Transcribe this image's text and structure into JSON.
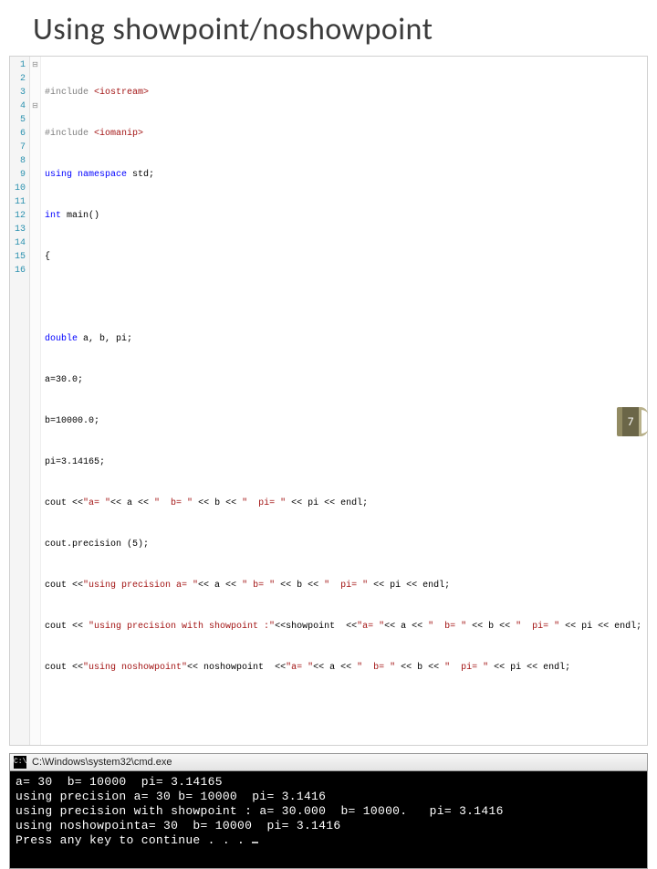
{
  "title": "Using showpoint/noshowpoint",
  "code": {
    "line_numbers": [
      "1",
      "2",
      "3",
      "4",
      "5",
      "6",
      "7",
      "8",
      "9",
      "10",
      "11",
      "12",
      "13",
      "14",
      "15",
      "16"
    ],
    "fold_markers": [
      "⊟",
      "",
      "",
      "⊟",
      "",
      "",
      "",
      "",
      "",
      "",
      "",
      "",
      "",
      "",
      "",
      ""
    ],
    "lines": {
      "l1_pp": "#include ",
      "l1_inc": "<iostream>",
      "l2_pp": "#include ",
      "l2_inc": "<iomanip>",
      "l3_kw": "using namespace ",
      "l3_rest": "std;",
      "l4_kw": "int ",
      "l4_rest": "main()",
      "l5": "{",
      "l6": "",
      "l7_kw": "double ",
      "l7_rest": "a, b, pi;",
      "l8": "a=30.0;",
      "l9": "b=10000.0;",
      "l10": "pi=3.14165;",
      "l11_a": "cout <<",
      "l11_s1": "\"a= \"",
      "l11_b": "<< a << ",
      "l11_s2": "\"  b= \"",
      "l11_c": " << b << ",
      "l11_s3": "\"  pi= \"",
      "l11_d": " << pi << endl;",
      "l12": "cout.precision (5);",
      "l13_a": "cout <<",
      "l13_s1": "\"using precision a= \"",
      "l13_b": "<< a << ",
      "l13_s2": "\" b= \"",
      "l13_c": " << b << ",
      "l13_s3": "\"  pi= \"",
      "l13_d": " << pi << endl;",
      "l14_a": "cout << ",
      "l14_s1": "\"using precision with showpoint :\"",
      "l14_b": "<<showpoint  <<",
      "l14_s2": "\"a= \"",
      "l14_c": "<< a << ",
      "l14_s3": "\"  b= \"",
      "l14_d": " << b << ",
      "l14_s4": "\"  pi= \"",
      "l14_e": " << pi << endl;",
      "l15_a": "cout <<",
      "l15_s1": "\"using noshowpoint\"",
      "l15_b": "<< noshowpoint  <<",
      "l15_s2": "\"a= \"",
      "l15_c": "<< a << ",
      "l15_s3": "\"  b= \"",
      "l15_d": " << b << ",
      "l15_s4": "\"  pi= \"",
      "l15_e": " << pi << endl;",
      "l16": ""
    }
  },
  "console": {
    "title": " C:\\Windows\\system32\\cmd.exe",
    "icon_text": "C:\\",
    "lines": [
      "a= 30  b= 10000  pi= 3.14165",
      "using precision a= 30 b= 10000  pi= 3.1416",
      "using precision with showpoint : a= 30.000  b= 10000.   pi= 3.1416",
      "using noshowpointa= 30  b= 10000  pi= 3.1416",
      "Press any key to continue . . . "
    ]
  },
  "page_number": "7"
}
